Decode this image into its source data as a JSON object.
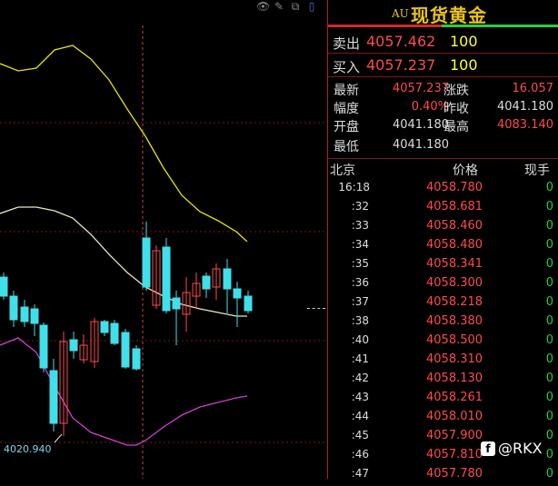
{
  "chart": {
    "low_label": "4020.940",
    "colors": {
      "up": "#ff4a4a",
      "down": "#3fe0ea",
      "ma_upper": "#e6e600",
      "ma_mid": "#e8e8c0",
      "ma_lower": "#d040d0",
      "grid": "#7a1818"
    }
  },
  "panel": {
    "symbol_tag": "AU",
    "title": "现货黄金",
    "sell": {
      "label": "卖出",
      "price": "4057.462",
      "volume": "100"
    },
    "buy": {
      "label": "买入",
      "price": "4057.237",
      "volume": "100"
    },
    "stats": [
      {
        "label": "最新",
        "value": "4057.237",
        "color": "#ff4a4a"
      },
      {
        "label": "涨跌",
        "value": "16.057",
        "color": "#ff4a4a"
      },
      {
        "label": "幅度",
        "value": "0.40%",
        "color": "#ff4a4a"
      },
      {
        "label": "昨收",
        "value": "4041.180",
        "color": "#dddddd"
      },
      {
        "label": "开盘",
        "value": "4041.180",
        "color": "#dddddd"
      },
      {
        "label": "最高",
        "value": "4083.140",
        "color": "#ff4a4a"
      },
      {
        "label": "最低",
        "value": "4041.180",
        "color": "#dddddd"
      }
    ],
    "ticks_header": {
      "time": "北京",
      "price": "价格",
      "volume": "现手"
    },
    "ticks": [
      {
        "time": "16:18",
        "price": "4058.780",
        "volume": "0"
      },
      {
        "time": ":32",
        "price": "4058.681",
        "volume": "0"
      },
      {
        "time": ":33",
        "price": "4058.460",
        "volume": "0"
      },
      {
        "time": ":34",
        "price": "4058.480",
        "volume": "0"
      },
      {
        "time": ":35",
        "price": "4058.341",
        "volume": "0"
      },
      {
        "time": ":36",
        "price": "4058.300",
        "volume": "0"
      },
      {
        "time": ":37",
        "price": "4058.218",
        "volume": "0"
      },
      {
        "time": ":38",
        "price": "4058.380",
        "volume": "0"
      },
      {
        "time": ":40",
        "price": "4058.500",
        "volume": "0"
      },
      {
        "time": ":41",
        "price": "4058.310",
        "volume": "0"
      },
      {
        "time": ":42",
        "price": "4058.130",
        "volume": "0"
      },
      {
        "time": ":43",
        "price": "4058.261",
        "volume": "0"
      },
      {
        "time": ":44",
        "price": "4058.010",
        "volume": "0"
      },
      {
        "time": ":45",
        "price": "4057.900",
        "volume": "0"
      },
      {
        "time": ":46",
        "price": "4057.810",
        "volume": "0"
      },
      {
        "time": ":47",
        "price": "4057.780",
        "volume": "0"
      }
    ]
  },
  "watermark": {
    "icon": "facebook-icon",
    "text": "@RKX"
  },
  "icons": [
    "eye-icon",
    "pencil-icon",
    "copy-icon",
    "bookmark-icon"
  ]
}
